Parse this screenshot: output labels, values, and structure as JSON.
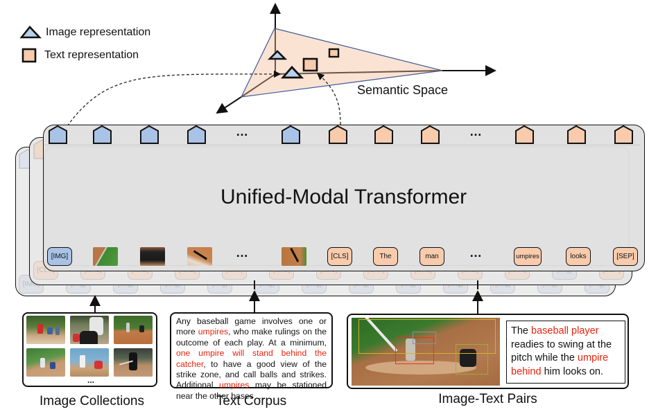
{
  "legend": {
    "items": [
      {
        "shape": "triangle",
        "label": "Image representation",
        "color": "#a9c3e6"
      },
      {
        "shape": "square",
        "label": "Text representation",
        "color": "#f8cbad"
      }
    ]
  },
  "semantic_space": {
    "label": "Semantic Space",
    "plane_color": "#fbe3d4",
    "points": [
      {
        "type": "image",
        "name": "image-point-small"
      },
      {
        "type": "image",
        "name": "image-point-large"
      },
      {
        "type": "text",
        "name": "text-point-large"
      },
      {
        "type": "text",
        "name": "text-point-small"
      }
    ]
  },
  "transformer": {
    "title": "Unified-Modal Transformer",
    "output_tokens": [
      "image",
      "image",
      "image",
      "image",
      "ellipsis",
      "image",
      "text",
      "text",
      "text",
      "ellipsis",
      "text",
      "text",
      "text"
    ],
    "input_tokens": [
      {
        "kind": "img",
        "label": "[IMG]"
      },
      {
        "kind": "photo",
        "label": "",
        "desc": "pitcher-crop"
      },
      {
        "kind": "photo",
        "label": "",
        "desc": "umpire-crop"
      },
      {
        "kind": "photo",
        "label": "",
        "desc": "batter-crop"
      },
      {
        "kind": "ellipsis",
        "label": "..."
      },
      {
        "kind": "photo",
        "label": "",
        "desc": "bat-crop"
      },
      {
        "kind": "txt",
        "label": "[CLS]"
      },
      {
        "kind": "txt",
        "label": "The"
      },
      {
        "kind": "txt",
        "label": "man"
      },
      {
        "kind": "ellipsis",
        "label": "..."
      },
      {
        "kind": "txt",
        "label": "umpires"
      },
      {
        "kind": "txt",
        "label": "looks"
      },
      {
        "kind": "txt",
        "label": "[SEP]"
      }
    ],
    "middle_layer_tokens": [
      "[CLS]",
      "[tok1]",
      "[tok2]",
      "[tok3]",
      "[tok4]",
      "[tok5]",
      "[tok6]",
      "[tok7]",
      "[tok8]",
      "[tok9]",
      "[tokN]",
      "[img]",
      "[SEP]"
    ],
    "back_layer_tokens": [
      "[IMG]",
      "[img]",
      "[img]",
      "[img]",
      "[img]",
      "[img]",
      "[img]",
      "[img]",
      "[img]",
      "[img]",
      "[img]",
      "[img]",
      "[img]"
    ],
    "ellipsis": "…"
  },
  "sources": {
    "image_collections": {
      "caption": "Image Collections",
      "ellipsis": "...",
      "thumbnails": [
        "batter-red-jersey",
        "batter-closeup-umpire",
        "batter-field-wide",
        "batter-swing-catcher",
        "batter-blue-sky",
        "batter-standing-fence"
      ]
    },
    "text_corpus": {
      "caption": "Text Corpus",
      "segments": [
        {
          "text": "Any baseball game involves one or more ",
          "highlight": false
        },
        {
          "text": "umpires",
          "highlight": true
        },
        {
          "text": ", who make rulings on the outcome of each play. At a minimum, ",
          "highlight": false
        },
        {
          "text": "one umpire will stand behind the catcher",
          "highlight": true
        },
        {
          "text": ", to have a good view of the strike zone, and call balls and strikes. Additional ",
          "highlight": false
        },
        {
          "text": "umpires",
          "highlight": true
        },
        {
          "text": " may be stationed near the other bases …",
          "highlight": false
        }
      ]
    },
    "image_text_pairs": {
      "caption": "Image-Text Pairs",
      "image_desc": "batter-and-umpire-with-bounding-boxes",
      "segments": [
        {
          "text": "The ",
          "highlight": false
        },
        {
          "text": "baseball player",
          "highlight": true
        },
        {
          "text": " readies to swing at the pitch while the ",
          "highlight": false
        },
        {
          "text": "umpire behind",
          "highlight": true
        },
        {
          "text": " him looks on.",
          "highlight": false
        }
      ]
    }
  },
  "colors": {
    "image_token": "#a9c3e6",
    "text_token": "#f8cbad",
    "highlight": "#e8230d",
    "layer_bg": "#e3e3e3"
  }
}
